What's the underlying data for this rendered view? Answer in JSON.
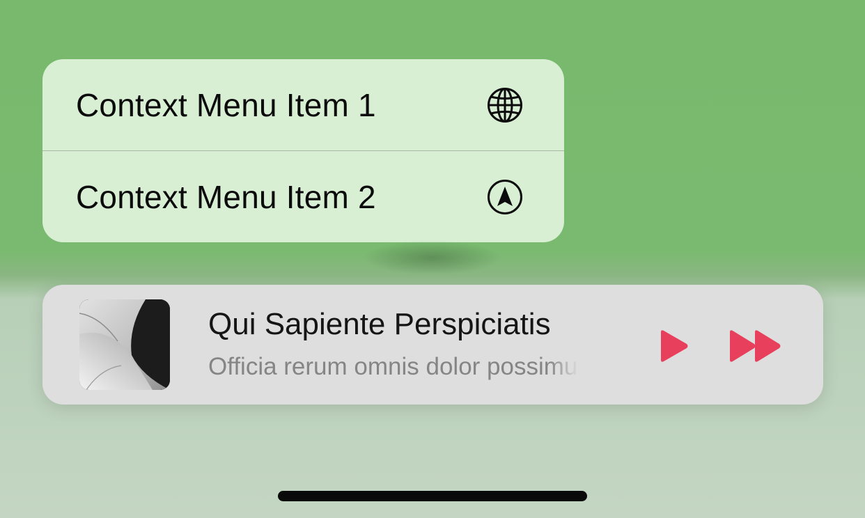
{
  "context_menu": {
    "items": [
      {
        "label": "Context Menu Item 1",
        "icon": "globe-icon"
      },
      {
        "label": "Context Menu Item 2",
        "icon": "location-arrow-circle-icon"
      }
    ]
  },
  "player": {
    "title": "Qui Sapiente Perspiciatis",
    "subtitle": "Officia rerum omnis dolor possimus",
    "controls": {
      "play_icon": "play-icon",
      "forward_icon": "fast-forward-icon"
    }
  },
  "colors": {
    "accent": "#e8405c",
    "menu_background": "#d8efd4",
    "player_background": "#dedede",
    "background_top": "#79b96e",
    "background_bottom": "#c4d6c3"
  }
}
